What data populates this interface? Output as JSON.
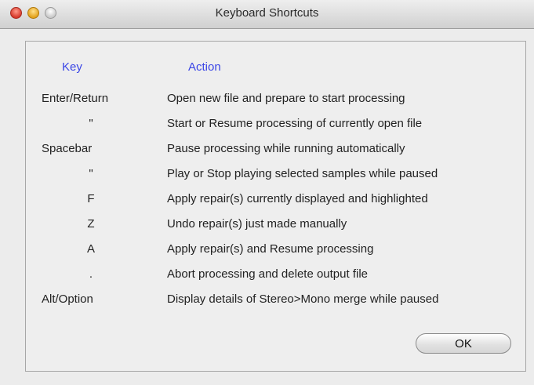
{
  "window": {
    "title": "Keyboard Shortcuts"
  },
  "table": {
    "headers": {
      "key": "Key",
      "action": "Action"
    },
    "rows": [
      {
        "key": "Enter/Return",
        "action": "Open new file and prepare to start processing"
      },
      {
        "key": "\"",
        "action": "Start or Resume processing of currently open file"
      },
      {
        "key": "Spacebar",
        "action": "Pause processing while running automatically"
      },
      {
        "key": "\"",
        "action": "Play or Stop playing selected samples while paused"
      },
      {
        "key": "F",
        "action": "Apply repair(s) currently displayed and highlighted"
      },
      {
        "key": "Z",
        "action": "Undo repair(s) just made manually"
      },
      {
        "key": "A",
        "action": "Apply repair(s) and Resume processing"
      },
      {
        "key": ".",
        "action": "Abort processing and delete output file"
      },
      {
        "key": "Alt/Option",
        "action": "Display details of Stereo>Mono merge while paused"
      }
    ]
  },
  "buttons": {
    "ok_label": "OK"
  },
  "colors": {
    "header_text": "#3a45e6",
    "close": "#d63a2c",
    "minimize": "#e3a21c",
    "zoom": "#c9c9c9"
  },
  "icons": {
    "close": "close-icon",
    "minimize": "minimize-icon",
    "zoom": "zoom-icon"
  }
}
